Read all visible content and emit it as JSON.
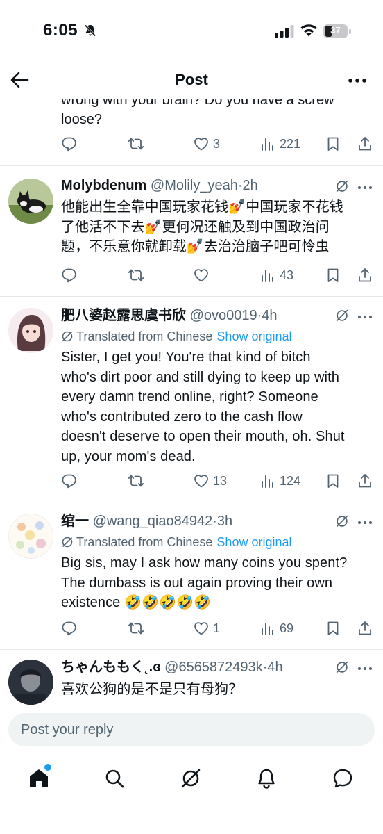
{
  "status_bar": {
    "time": "6:05",
    "battery": "37",
    "battery_level": 0.37
  },
  "header": {
    "title": "Post",
    "back_icon": "arrow-left-icon",
    "more_icon": "more-dots-icon"
  },
  "partial_tweet": {
    "lines": [
      "wrong with your brain? Do you have a screw",
      "loose?"
    ],
    "replies": "",
    "reposts": "",
    "likes": "3",
    "views": "221"
  },
  "tweets": [
    {
      "display_name": "Molybdenum",
      "handle": "@Molily_yeah",
      "time": "2h",
      "translated": false,
      "lines": [
        "他能出生全靠中国玩家花钱💅中国玩家不花钱",
        "了他活不下去💅更何况还触及到中国政治问",
        "题，不乐意你就卸载💅去治治脑子吧可怜虫"
      ],
      "likes": "",
      "views": "43"
    },
    {
      "display_name": "肥八婆赵露思虞书欣",
      "handle": "@ovo0019",
      "time": "4h",
      "translated": true,
      "translated_label": "Translated from Chinese",
      "show_original": "Show original",
      "lines": [
        "Sister, I get you! You're that kind of bitch",
        "who's dirt poor and still dying to keep up with",
        "every damn trend online, right? Someone",
        "who's contributed zero to the cash flow",
        "doesn't deserve to open their mouth, oh. Shut",
        "up, your mom's dead."
      ],
      "likes": "13",
      "views": "124"
    },
    {
      "display_name": "绾一",
      "handle": "@wang_qiao84942",
      "time": "3h",
      "translated": true,
      "translated_label": "Translated from Chinese",
      "show_original": "Show original",
      "lines": [
        "Big sis, may I ask how many coins you spent?",
        "The dumbass is out again proving their own",
        "existence 🤣🤣🤣🤣🤣"
      ],
      "likes": "1",
      "views": "69"
    },
    {
      "display_name": "ちゃんももく˛.ɞ",
      "handle": "@6565872493k",
      "time": "4h",
      "translated": false,
      "lines": [
        "喜欢公狗的是不是只有母狗？"
      ],
      "likes": "",
      "views": ""
    }
  ],
  "reply": {
    "placeholder": "Post your reply"
  },
  "colors": {
    "accent": "#1d9bf0",
    "text": "#0f1419",
    "secondary": "#536471",
    "divider": "#e6e8ea"
  },
  "icons": {
    "reply": "reply-icon",
    "repost": "repost-icon",
    "like": "heart-icon",
    "views": "views-icon",
    "bookmark": "bookmark-icon",
    "share": "share-icon"
  }
}
